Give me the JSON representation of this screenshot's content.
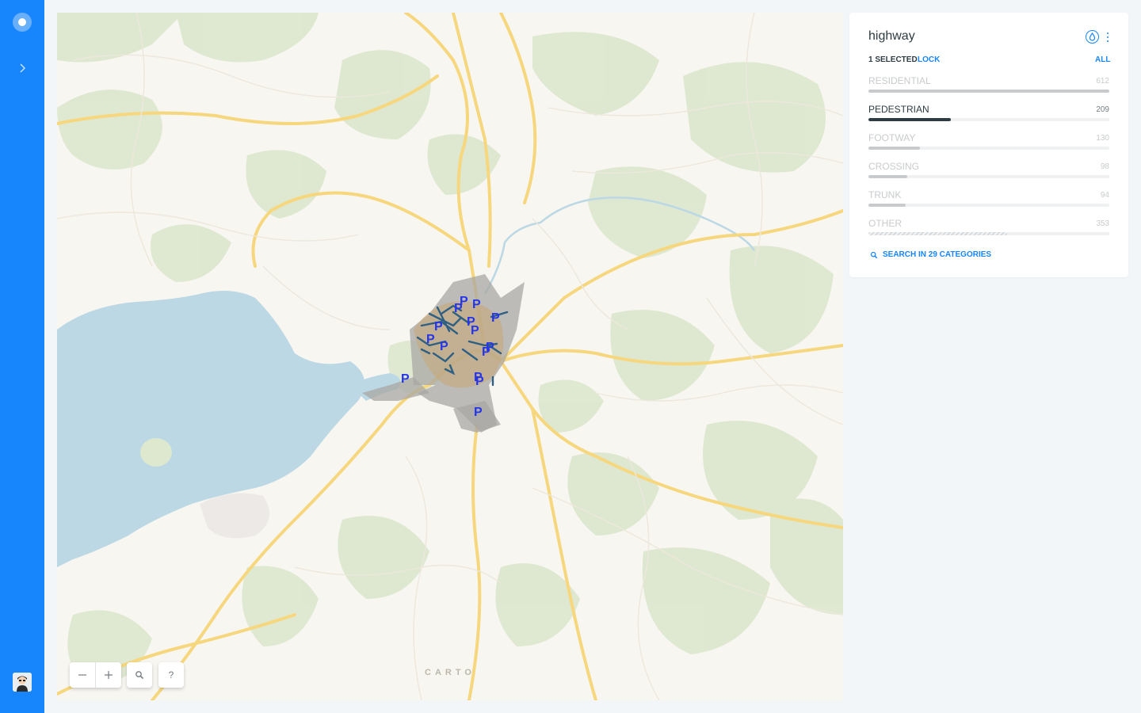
{
  "app": {
    "colors": {
      "accent": "#1785FB",
      "text": "#2E3C43",
      "muted": "#C8CBCD"
    }
  },
  "sidebar": {
    "logo_icon": "carto-logo-icon",
    "expand_icon": "chevron-right-icon",
    "avatar_icon": "user-avatar"
  },
  "map": {
    "attribution": "CARTO",
    "controls": {
      "zoom_out_icon": "minus-icon",
      "zoom_in_icon": "plus-icon",
      "search_icon": "search-icon",
      "help_label": "?"
    },
    "marker_label": "P"
  },
  "widget": {
    "title": "highway",
    "selection_status": "1 SELECTED",
    "lock_label": "LOCK",
    "all_label": "ALL",
    "icons": [
      "color-drop-icon",
      "more-vertical-icon"
    ],
    "categories": [
      {
        "label": "RESIDENTIAL",
        "count": "612",
        "value": 612,
        "selected": false
      },
      {
        "label": "PEDESTRIAN",
        "count": "209",
        "value": 209,
        "selected": true
      },
      {
        "label": "FOOTWAY",
        "count": "130",
        "value": 130,
        "selected": false
      },
      {
        "label": "CROSSING",
        "count": "98",
        "value": 98,
        "selected": false
      },
      {
        "label": "TRUNK",
        "count": "94",
        "value": 94,
        "selected": false
      },
      {
        "label": "OTHER",
        "count": "353",
        "value": 353,
        "selected": false
      }
    ],
    "search_label": "SEARCH IN 29 CATEGORIES"
  }
}
